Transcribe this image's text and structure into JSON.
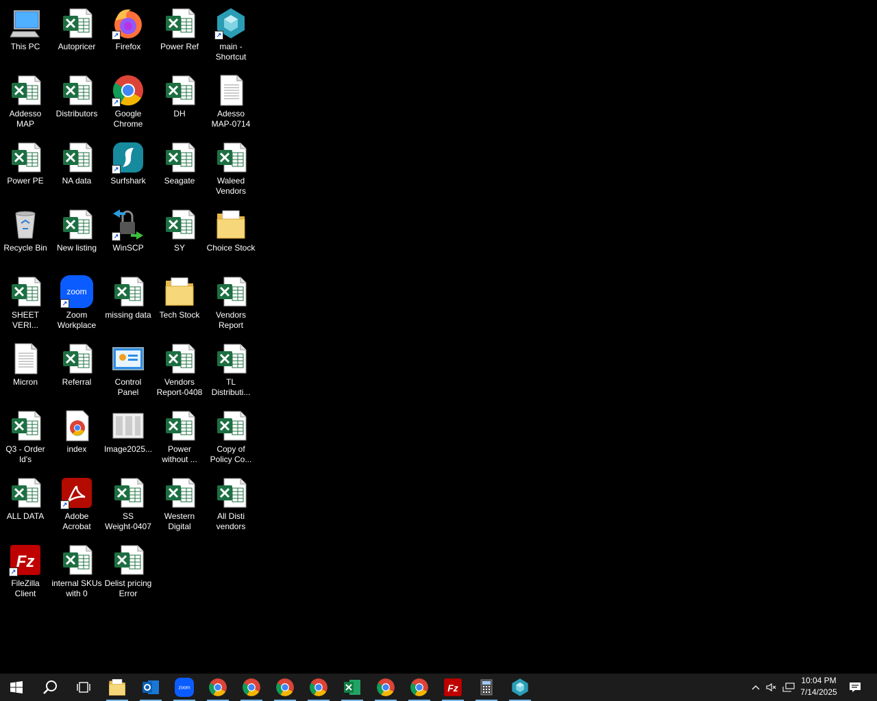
{
  "desktop": {
    "icons": [
      {
        "label": "This PC",
        "icon": "computer-icon"
      },
      {
        "label": "Autopricer",
        "icon": "excel-file-icon"
      },
      {
        "label": "Firefox",
        "icon": "firefox-icon"
      },
      {
        "label": "Power Ref",
        "icon": "excel-file-icon"
      },
      {
        "label": "main -\nShortcut",
        "icon": "app-shortcut-icon"
      },
      {
        "label": "Addesso\nMAP",
        "icon": "excel-file-icon"
      },
      {
        "label": "Distributors",
        "icon": "excel-file-icon"
      },
      {
        "label": "Google\nChrome",
        "icon": "chrome-icon"
      },
      {
        "label": "DH",
        "icon": "excel-file-icon"
      },
      {
        "label": "Adesso\nMAP-0714",
        "icon": "text-file-icon"
      },
      {
        "label": "Power PE",
        "icon": "excel-file-icon"
      },
      {
        "label": "NA data",
        "icon": "excel-file-icon"
      },
      {
        "label": "Surfshark",
        "icon": "surfshark-icon"
      },
      {
        "label": "Seagate",
        "icon": "excel-file-icon"
      },
      {
        "label": "Waleed\nVendors",
        "icon": "excel-file-icon"
      },
      {
        "label": "Recycle Bin",
        "icon": "recycle-bin-icon"
      },
      {
        "label": "New listing",
        "icon": "excel-file-icon"
      },
      {
        "label": "WinSCP",
        "icon": "winscp-icon"
      },
      {
        "label": "SY",
        "icon": "excel-file-icon"
      },
      {
        "label": "Choice Stock",
        "icon": "folder-icon"
      },
      {
        "label": "SHEET\nVERI...",
        "icon": "excel-file-icon"
      },
      {
        "label": "Zoom\nWorkplace",
        "icon": "zoom-icon"
      },
      {
        "label": "missing data",
        "icon": "excel-file-icon"
      },
      {
        "label": "Tech Stock",
        "icon": "folder-icon"
      },
      {
        "label": "Vendors\nReport",
        "icon": "excel-file-icon"
      },
      {
        "label": "Micron",
        "icon": "text-file-icon"
      },
      {
        "label": "Referral",
        "icon": "excel-file-icon"
      },
      {
        "label": "Control\nPanel",
        "icon": "control-panel-icon"
      },
      {
        "label": "Vendors\nReport-0408",
        "icon": "excel-file-icon"
      },
      {
        "label": "TL\nDistributi...",
        "icon": "excel-file-icon"
      },
      {
        "label": "Q3 - Order\nId's",
        "icon": "excel-file-icon"
      },
      {
        "label": "index",
        "icon": "chrome-html-file-icon"
      },
      {
        "label": "Image2025...",
        "icon": "image-file-icon"
      },
      {
        "label": "Power\nwithout ...",
        "icon": "excel-file-icon"
      },
      {
        "label": "Copy of\nPolicy Co...",
        "icon": "excel-file-icon"
      },
      {
        "label": "ALL DATA",
        "icon": "excel-file-icon"
      },
      {
        "label": "Adobe\nAcrobat",
        "icon": "acrobat-icon"
      },
      {
        "label": "SS\nWeight-0407",
        "icon": "excel-file-icon"
      },
      {
        "label": "Western\nDigital",
        "icon": "excel-file-icon"
      },
      {
        "label": "All Disti\nvendors",
        "icon": "excel-file-icon"
      },
      {
        "label": "FileZilla\nClient",
        "icon": "filezilla-icon"
      },
      {
        "label": "internal SKUs\nwith 0",
        "icon": "excel-file-icon"
      },
      {
        "label": "Delist pricing\nError",
        "icon": "excel-file-icon"
      }
    ]
  },
  "taskbar": {
    "apps": [
      {
        "name": "start-button",
        "icon": "windows-logo-icon"
      },
      {
        "name": "search-button",
        "icon": "search-icon"
      },
      {
        "name": "task-view-button",
        "icon": "task-view-icon"
      },
      {
        "name": "taskbar-file-explorer",
        "icon": "folder-icon"
      },
      {
        "name": "taskbar-outlook",
        "icon": "outlook-icon"
      },
      {
        "name": "taskbar-zoom",
        "icon": "zoom-icon"
      },
      {
        "name": "taskbar-chrome-1",
        "icon": "chrome-icon"
      },
      {
        "name": "taskbar-chrome-2",
        "icon": "chrome-icon"
      },
      {
        "name": "taskbar-chrome-3",
        "icon": "chrome-icon"
      },
      {
        "name": "taskbar-chrome-4",
        "icon": "chrome-icon"
      },
      {
        "name": "taskbar-excel",
        "icon": "excel-icon"
      },
      {
        "name": "taskbar-chrome-5",
        "icon": "chrome-icon"
      },
      {
        "name": "taskbar-chrome-6",
        "icon": "chrome-icon"
      },
      {
        "name": "taskbar-filezilla",
        "icon": "filezilla-icon"
      },
      {
        "name": "taskbar-calculator",
        "icon": "calculator-icon"
      },
      {
        "name": "taskbar-main-app",
        "icon": "app-shortcut-icon"
      }
    ],
    "clock": {
      "time": "10:04 PM",
      "date": "7/14/2025"
    }
  },
  "colors": {
    "excel_green": "#1d6f42",
    "taskbar_bg": "#1c1c1c",
    "accent": "#76b9ed"
  }
}
